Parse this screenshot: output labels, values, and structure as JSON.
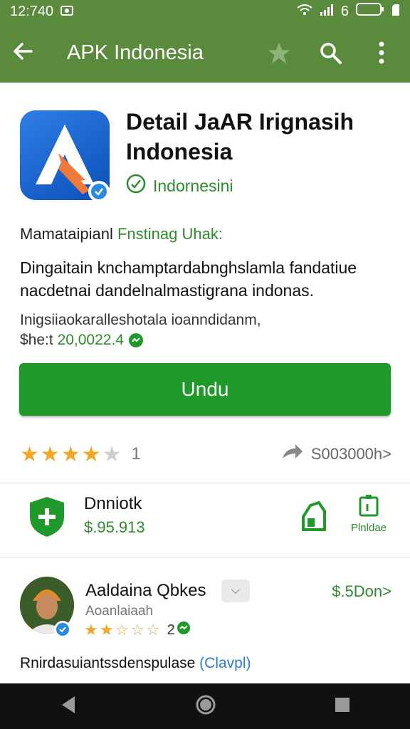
{
  "status_bar": {
    "time": "12:740",
    "battery": "6"
  },
  "app_bar": {
    "title": "APK Indonesia",
    "back_icon": "arrow-left-icon",
    "star_icon": "star-icon",
    "search_icon": "search-icon",
    "more_icon": "more-vert-icon"
  },
  "app": {
    "title": "Detail JaAR Irignasih Indonesia",
    "developer": "Indornesini",
    "meta_label": "Mamataipianl",
    "meta_value": "Fnstinag Uhak:",
    "description": "Dingaitain knchamptardabnghslamla fandatiue nacdetnai dandelnalmastigrana indonas.",
    "sub_text": "Inigsiiaokaralleshotala ioanndidanm,",
    "sub_prefix": "$he:t",
    "sub_date": "20,0022.4"
  },
  "install_button": {
    "label": "Undu"
  },
  "rating": {
    "value": 4,
    "count": "1",
    "share_text": "S003000h>"
  },
  "security": {
    "title": "Dnniotk",
    "value": "$.95.913",
    "label2": "Plnldae"
  },
  "review": {
    "name": "Aaldaina Qbkes",
    "sub": "Aoanlaiaah",
    "stars": 2.5,
    "count": "2",
    "price": "$.5Don>",
    "text": "Rnirdasuiantssdenspulase",
    "link": "(Clavpl)"
  },
  "colors": {
    "appbar": "#5a8a3c",
    "accent_green": "#1f9a2a",
    "text_green": "#2e8b2e",
    "star": "#f5a623"
  }
}
